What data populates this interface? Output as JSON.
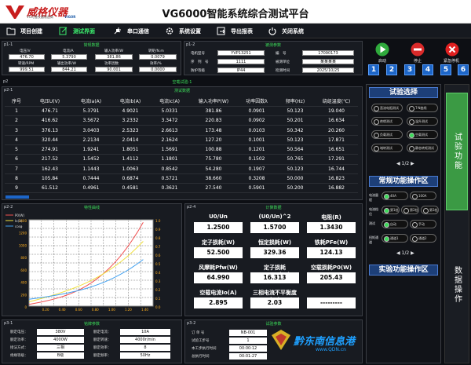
{
  "title": "VG6000智能系统综合测试平台",
  "logo": {
    "name": "威格仪器",
    "sub": "VG可靠仪器制造商",
    "en": "VIGOR"
  },
  "menu": [
    {
      "label": "项目创建",
      "icon": "folder-icon"
    },
    {
      "label": "测试界面",
      "icon": "edit-icon",
      "active": true
    },
    {
      "label": "串口通信",
      "icon": "plug-icon"
    },
    {
      "label": "系统设置",
      "icon": "gear-icon"
    },
    {
      "label": "导出报表",
      "icon": "export-icon"
    },
    {
      "label": "关闭系统",
      "icon": "power-icon"
    }
  ],
  "p1_1": {
    "tag": "p1-1",
    "title": "常规数据",
    "labels": [
      "电压/V",
      "电流/A",
      "输入功率/W",
      "转矩/N.m",
      "转速/RPM",
      "输出功率/W",
      "功率因数",
      "效率/%"
    ],
    "values": [
      "476.70",
      "5.3790",
      "381.86",
      "0.0079",
      "999.51",
      "844.21",
      "90.001",
      "0.0000"
    ]
  },
  "p1_2": {
    "tag": "p1-2",
    "title": "被测参数",
    "fields": [
      {
        "label": "电机型号",
        "value": "YVP13251"
      },
      {
        "label": "编　号",
        "value": "17090173"
      },
      {
        "label": "序　列　号",
        "value": "1111"
      },
      {
        "label": "被测单位",
        "value": "某某某某"
      },
      {
        "label": "防护等级",
        "value": "IP44"
      },
      {
        "label": "检测时间",
        "value": "2025/10/25"
      }
    ]
  },
  "actions": {
    "start": "启动",
    "stop": "停止",
    "estop": "紧急停机",
    "nums": [
      "1",
      "2",
      "3",
      "4",
      "5",
      "6"
    ]
  },
  "p2": {
    "tag": "p2",
    "title": "空载试验-1"
  },
  "p2_1": {
    "tag": "p2-1",
    "title": "测试数据",
    "headers": [
      "序号",
      "电压U(V)",
      "电流Ia(A)",
      "电流Ib(A)",
      "电流Ic(A)",
      "输入功率P(W)",
      "功率因数λ",
      "频率(Hz)",
      "绕组温度(℃)"
    ],
    "rows": [
      [
        "1",
        "476.71",
        "5.3791",
        "4.9021",
        "5.0331",
        "381.86",
        "0.0901",
        "50.123",
        "19.040"
      ],
      [
        "2",
        "416.62",
        "3.5672",
        "3.2332",
        "3.3472",
        "220.83",
        "0.0902",
        "50.201",
        "16.634"
      ],
      [
        "3",
        "376.13",
        "3.0403",
        "2.5323",
        "2.6613",
        "173.48",
        "0.0103",
        "50.342",
        "20.260"
      ],
      [
        "4",
        "320.44",
        "2.2134",
        "2.0414",
        "2.1624",
        "127.20",
        "0.1001",
        "50.123",
        "17.871"
      ],
      [
        "5",
        "274.91",
        "1.9241",
        "1.8051",
        "1.5691",
        "100.88",
        "0.1201",
        "50.564",
        "16.651"
      ],
      [
        "6",
        "217.52",
        "1.5452",
        "1.4112",
        "1.1801",
        "75.780",
        "0.1502",
        "50.765",
        "17.291"
      ],
      [
        "7",
        "162.43",
        "1.1443",
        "1.0063",
        "0.8542",
        "54.280",
        "0.1907",
        "50.123",
        "16.744"
      ],
      [
        "8",
        "105.84",
        "0.7444",
        "0.6874",
        "0.5721",
        "38.660",
        "0.3208",
        "50.000",
        "16.823"
      ],
      [
        "9",
        "61.512",
        "0.4961",
        "0.4581",
        "0.3621",
        "27.540",
        "0.5901",
        "50.200",
        "16.882"
      ]
    ]
  },
  "p2_2": {
    "tag": "p2-2",
    "title": "特性曲线",
    "legend": [
      "P0(W)",
      "Io(A)",
      "cosφ"
    ],
    "yleft": [
      "1400",
      "1200",
      "1000",
      "800",
      "600",
      "400",
      "200",
      "0"
    ],
    "yright": [
      "1.0",
      "0.9",
      "0.8",
      "0.7",
      "0.6",
      "0.5",
      "0.4",
      "0.3",
      "0.2",
      "0.1",
      "0.0"
    ],
    "xticks": [
      "0.20",
      "0.40",
      "0.60",
      "0.80",
      "1.00",
      "1.20",
      "1.40"
    ]
  },
  "p2_4": {
    "tag": "p2-4",
    "title": "计算数据",
    "items": [
      {
        "label": "U0/Un",
        "value": "1.2500"
      },
      {
        "label": "(U0/Un)^2",
        "value": "1.5700"
      },
      {
        "label": "电阻(R)",
        "value": "1.3430"
      },
      {
        "label": "定子损耗(W)",
        "value": "52.500"
      },
      {
        "label": "恒定损耗(W)",
        "value": "329.36"
      },
      {
        "label": "铁耗PFe(W)",
        "value": "124.13"
      },
      {
        "label": "风摩耗Pfw(W)",
        "value": "64.990"
      },
      {
        "label": "定子损耗P0Cu1(W)",
        "value": "16.313"
      },
      {
        "label": "空载损耗P0(W)",
        "value": "205.43"
      },
      {
        "label": "空载电流Io(A)",
        "value": "2.895"
      },
      {
        "label": "三相电流不平衡度(%)",
        "value": "2.03"
      },
      {
        "label": "",
        "value": "---------"
      }
    ]
  },
  "p3_1": {
    "tag": "p3-1",
    "title": "铭牌参数",
    "fields": [
      {
        "label": "额定电压：",
        "value": "380V"
      },
      {
        "label": "额定电流：",
        "value": "10A"
      },
      {
        "label": "额定功率：",
        "value": "4000W"
      },
      {
        "label": "额定转速：",
        "value": "4000r/min"
      },
      {
        "label": "接法方式：",
        "value": "三相"
      },
      {
        "label": "额定效率：",
        "value": "8"
      },
      {
        "label": "绝缘等级：",
        "value": "B级"
      },
      {
        "label": "额定频率：",
        "value": "50Hz"
      }
    ]
  },
  "p3_2": {
    "tag": "p3-2",
    "title": "试验参数",
    "fields": [
      {
        "label": "订 单 号",
        "value": "NB-001"
      },
      {
        "label": "试验工步号",
        "value": "1"
      },
      {
        "label": "本工步执行时间",
        "value": "00:00:12"
      },
      {
        "label": "总执行时间",
        "value": "00:01:27"
      }
    ]
  },
  "right": {
    "sec1": "试验选择",
    "tests": [
      "直流电阻测试",
      "T-N曲线",
      "绝缘测试",
      "温升测试",
      "负载测试",
      "空载测试",
      "堵转测试",
      "静态转矩测试"
    ],
    "page1": "1/2",
    "sec2": "常规功能操作区",
    "rows": [
      {
        "label": "电流量程",
        "opts": [
          "40A",
          "100A"
        ]
      },
      {
        "label": "电流档位",
        "opts": [
          "第1档",
          "第2档",
          "第3档"
        ]
      },
      {
        "label": "测试",
        "opts": [
          "自动",
          "手动"
        ]
      },
      {
        "label": "扭矩通道",
        "opts": [
          "通道1",
          "通道2"
        ]
      }
    ],
    "page2": "1/2",
    "sec3": "实验功能操作区",
    "tab1": "试验功能",
    "tab2": "数据操作"
  },
  "watermark": {
    "cn": "黔东南信息港",
    "url": "www.QDN.cn"
  }
}
